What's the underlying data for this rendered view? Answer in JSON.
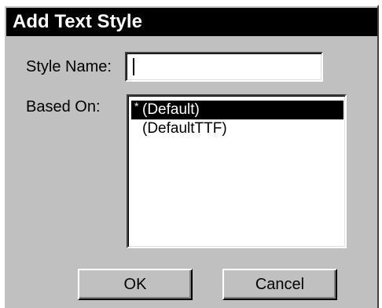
{
  "dialog": {
    "title": "Add Text Style"
  },
  "style_name": {
    "label": "Style Name:",
    "value": ""
  },
  "based_on": {
    "label": "Based On:",
    "items": [
      {
        "marker": "*",
        "label": "(Default)",
        "selected": true
      },
      {
        "marker": "",
        "label": "(DefaultTTF)",
        "selected": false
      }
    ]
  },
  "buttons": {
    "ok": "OK",
    "cancel": "Cancel"
  },
  "colors": {
    "dialog_face": "#c0c0c0",
    "title_bar": "#000000",
    "selection": "#000000"
  }
}
